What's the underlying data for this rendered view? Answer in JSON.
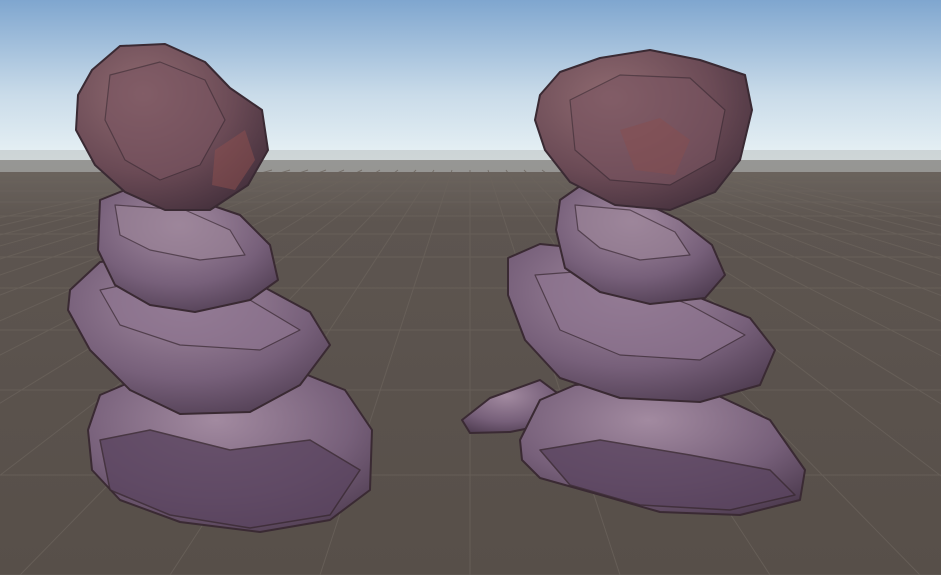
{
  "scene": {
    "description_key": "unity-editor-scene-view",
    "objects": [
      {
        "name": "rock-stack-left"
      },
      {
        "name": "rock-stack-right"
      }
    ],
    "colors": {
      "sky_top": "#7fa6cf",
      "sky_horizon": "#e9f3f6",
      "ground": "#5a524c",
      "grid_line": "#6a615b",
      "rock_base": "#6e5566",
      "rock_light": "#9a8094",
      "rock_dark": "#4a3545",
      "rock_red": "#7a4a4a",
      "outline": "#3a2a33"
    }
  }
}
